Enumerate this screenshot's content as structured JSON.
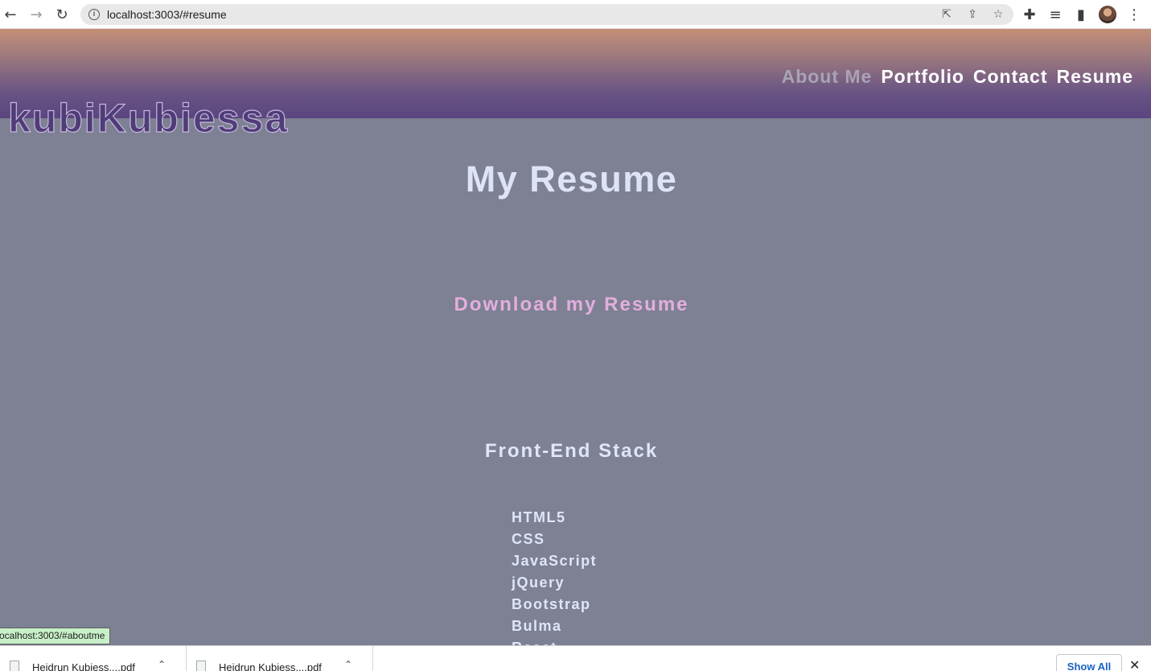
{
  "browser": {
    "url": "localhost:3003/#resume",
    "icons": {
      "back": "arrow-left-icon",
      "forward": "arrow-right-icon",
      "reload": "reload-icon",
      "info": "info-icon",
      "open_in_app": "open-external-icon",
      "share": "share-icon",
      "bookmark": "star-icon",
      "extensions": "puzzle-icon",
      "media": "media-queue-icon",
      "side_panel": "side-panel-icon",
      "menu": "kebab-menu-icon"
    }
  },
  "site": {
    "logo": "kubiKubiessa",
    "nav": [
      {
        "label": "About Me",
        "active": false
      },
      {
        "label": "Portfolio",
        "active": true
      },
      {
        "label": "Contact",
        "active": true
      },
      {
        "label": "Resume",
        "active": true
      }
    ]
  },
  "main": {
    "title": "My Resume",
    "download_link": "Download my Resume",
    "section_title": "Front-End Stack",
    "skills": [
      "HTML5",
      "CSS",
      "JavaScript",
      "jQuery",
      "Bootstrap",
      "Bulma",
      "React"
    ]
  },
  "status_bar": {
    "text": "ocalhost:3003/#aboutme"
  },
  "downloads": {
    "items": [
      {
        "name": "Heidrun Kubiess....pdf"
      },
      {
        "name": "Heidrun Kubiess....pdf"
      }
    ],
    "show_all": "Show All"
  },
  "colors": {
    "page_bg": "#7d8193",
    "header_top": "#c48f76",
    "header_bottom": "#5a4580",
    "download_link": "#e3aede",
    "text": "#dfe4f4"
  }
}
